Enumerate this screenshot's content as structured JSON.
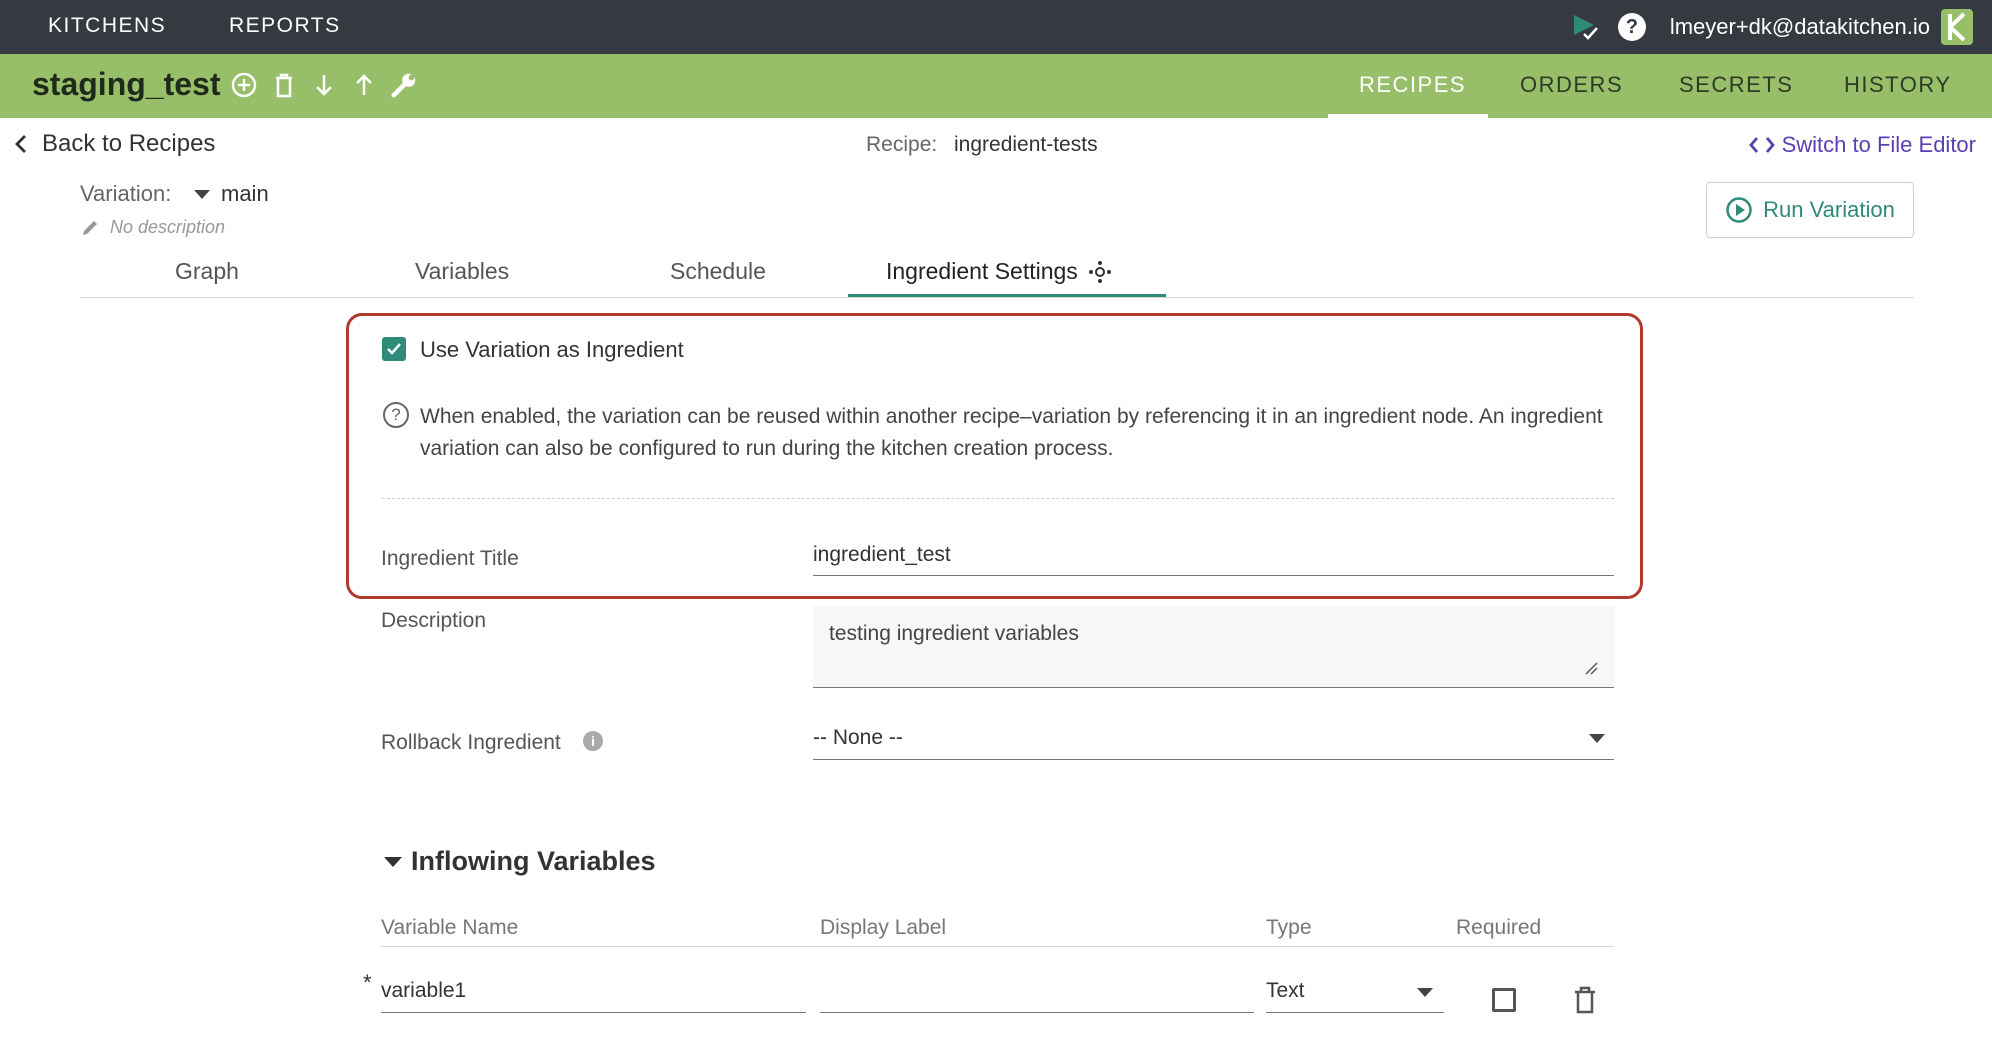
{
  "topbar": {
    "nav": [
      "KITCHENS",
      "REPORTS"
    ],
    "user_email": "lmeyer+dk@datakitchen.io",
    "help_glyph": "?",
    "icons": [
      "play-check-icon",
      "help-icon",
      "datakitchen-logo-icon"
    ]
  },
  "kitchen": {
    "name": "staging_test",
    "tools": [
      "add-circle-icon",
      "trash-icon",
      "arrow-down-icon",
      "arrow-up-icon",
      "wrench-icon"
    ],
    "tabs": [
      "RECIPES",
      "ORDERS",
      "SECRETS",
      "HISTORY"
    ],
    "active_tab": "RECIPES"
  },
  "recipe_header": {
    "back_label": "Back to Recipes",
    "recipe_label": "Recipe:",
    "recipe_name": "ingredient-tests",
    "switch_editor_label": "Switch to File Editor",
    "variation_label": "Variation:",
    "variation_value": "main",
    "no_description": "No description",
    "run_button_label": "Run Variation"
  },
  "tabs": {
    "items": [
      "Graph",
      "Variables",
      "Schedule",
      "Ingredient Settings"
    ],
    "active": "Ingredient Settings"
  },
  "settings": {
    "use_as_ingredient_label": "Use Variation as Ingredient",
    "use_as_ingredient_checked": true,
    "help_text": "When enabled, the variation can be reused within another recipe–variation by referencing it in an ingredient node. An ingredient variation can also be configured to run during the kitchen creation process.",
    "ingredient_title_label": "Ingredient Title",
    "ingredient_title_value": "ingredient_test",
    "description_label": "Description",
    "description_value": "testing ingredient variables",
    "rollback_label": "Rollback Ingredient",
    "rollback_value": "-- None --",
    "info_glyph": "i"
  },
  "inflowing": {
    "title": "Inflowing Variables",
    "columns": [
      "Variable Name",
      "Display Label",
      "Type",
      "Required"
    ],
    "rows": [
      {
        "required_marker": "*",
        "name": "variable1",
        "display_label": "",
        "type": "Text",
        "required": false
      }
    ]
  },
  "colors": {
    "topbar": "#343a3f",
    "kitchen_bar": "#97bf6a",
    "accent_teal": "#2e8b7a",
    "link_purple": "#5a3fb5",
    "highlight_red": "#b03a2e"
  }
}
